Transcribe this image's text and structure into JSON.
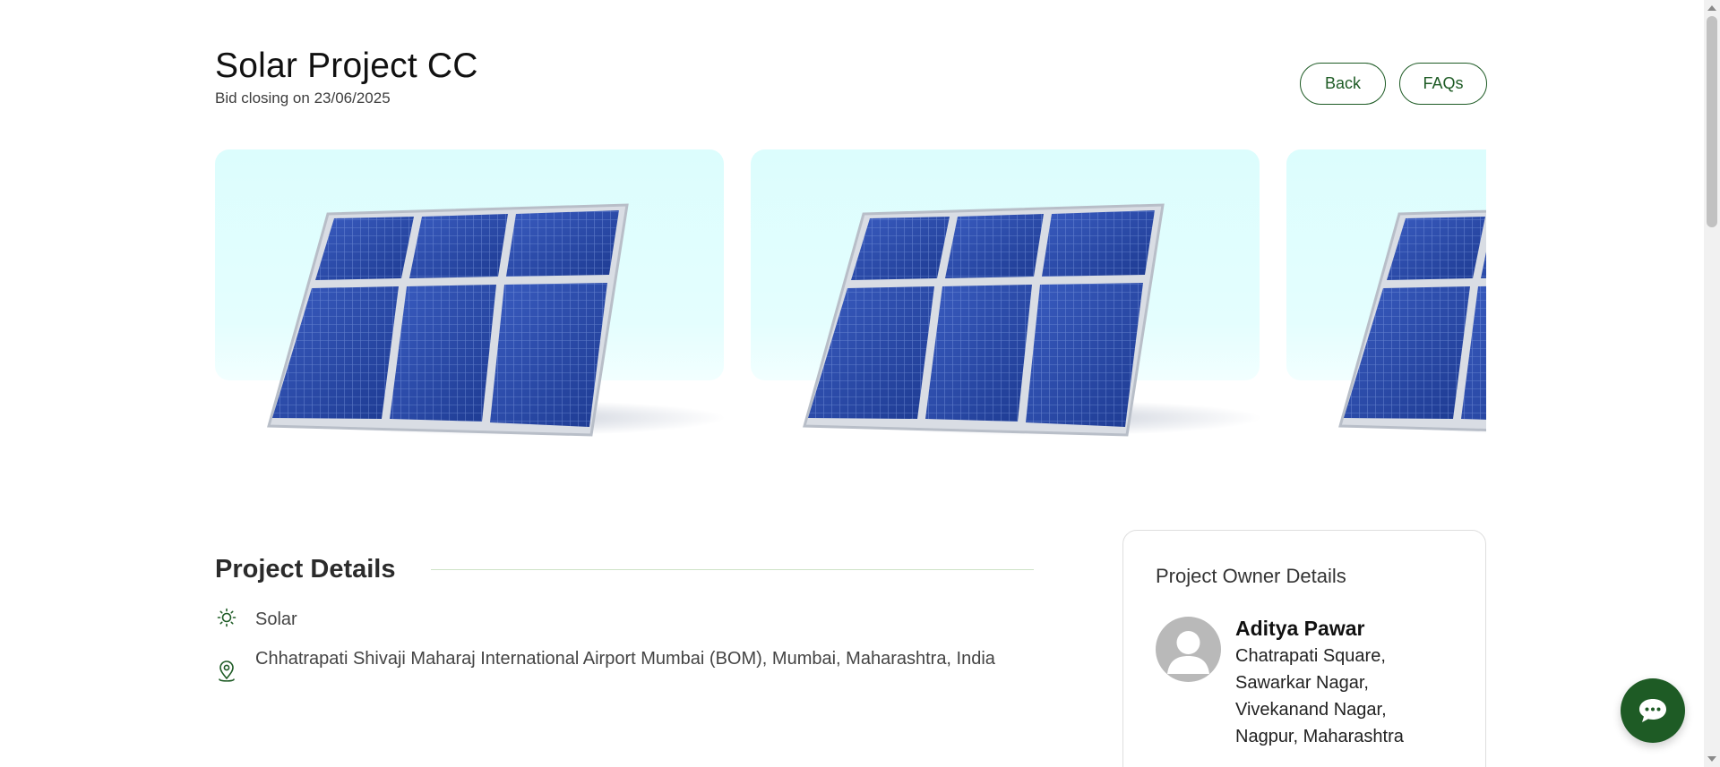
{
  "header": {
    "title": "Solar Project CC",
    "bid_closing": "Bid closing on 23/06/2025",
    "back_label": "Back",
    "faqs_label": "FAQs"
  },
  "carousel": {
    "image_subject": "solar-panels",
    "slides_visible": 3
  },
  "project_details": {
    "heading": "Project Details",
    "type": "Solar",
    "type_icon": "sun-icon",
    "location": "Chhatrapati Shivaji Maharaj International Airport Mumbai (BOM), Mumbai, Maharashtra, India",
    "location_icon": "map-pin-icon"
  },
  "owner": {
    "heading": "Project Owner Details",
    "name": "Aditya Pawar",
    "address": "Chatrapati Square, Sawarkar Nagar, Vivekanand Nagar, Nagpur, Maharashtra"
  },
  "chat": {
    "icon": "chat-bubble-icon"
  },
  "colors": {
    "accent": "#1e5b25",
    "sky": "#dcfdfd",
    "panel": "#2a4aa6",
    "divider": "#cfe3c7"
  }
}
